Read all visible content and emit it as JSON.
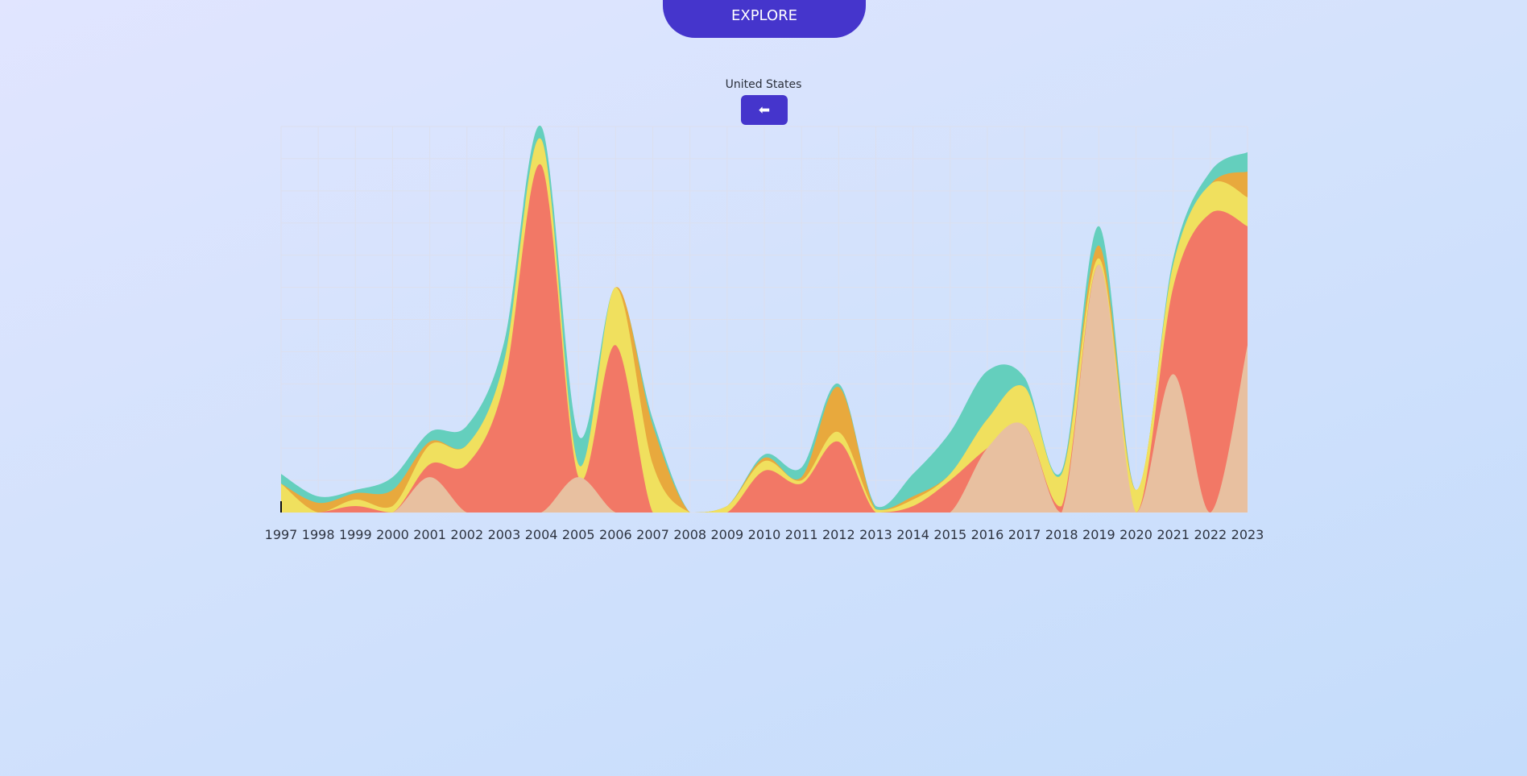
{
  "header": {
    "explore_label": "EXPLORE"
  },
  "country": {
    "name": "United States",
    "back_icon": "left-arrow-icon",
    "back_glyph": "⬅"
  },
  "chart_data": {
    "type": "area",
    "stacked": true,
    "smooth": true,
    "grid": true,
    "x": [
      "1997",
      "1998",
      "1999",
      "2000",
      "2001",
      "2002",
      "2003",
      "2004",
      "2005",
      "2006",
      "2007",
      "2008",
      "2009",
      "2010",
      "2011",
      "2012",
      "2013",
      "2014",
      "2015",
      "2016",
      "2017",
      "2018",
      "2019",
      "2020",
      "2021",
      "2022",
      "2023"
    ],
    "ylim": [
      0,
      120
    ],
    "colors": [
      "#e8c0a0",
      "#f27866",
      "#f0e05e",
      "#e8a93d",
      "#64cfbd"
    ],
    "series": [
      {
        "values": [
          0,
          0,
          0,
          0,
          11,
          0,
          0,
          0,
          11,
          0,
          0,
          0,
          0,
          0,
          0,
          0,
          0,
          0,
          0,
          20,
          27,
          0,
          77,
          0,
          43,
          0,
          52
        ]
      },
      {
        "values": [
          0,
          0,
          2,
          0,
          4,
          15,
          40,
          108,
          0,
          52,
          0,
          0,
          0,
          13,
          9,
          22,
          0,
          2,
          10,
          0,
          0,
          2,
          0,
          0,
          27,
          93,
          37
        ]
      },
      {
        "values": [
          9,
          0,
          2,
          2,
          6,
          6,
          7,
          8,
          4,
          18,
          15,
          0,
          2,
          3,
          1,
          3,
          1,
          2,
          2,
          9,
          12,
          10,
          2,
          7,
          7,
          9,
          9
        ]
      },
      {
        "values": [
          0,
          3,
          2,
          5,
          1,
          0,
          0,
          0,
          0,
          0,
          12,
          0,
          0,
          1,
          1,
          14,
          0,
          1,
          0,
          0,
          0,
          0,
          4,
          0,
          0,
          0,
          8
        ]
      },
      {
        "values": [
          3,
          2,
          1,
          4,
          3,
          6,
          6,
          4,
          9,
          0,
          2,
          0,
          0,
          1,
          3,
          1,
          1,
          7,
          13,
          15,
          3,
          1,
          6,
          0,
          2,
          4,
          6
        ]
      }
    ]
  }
}
